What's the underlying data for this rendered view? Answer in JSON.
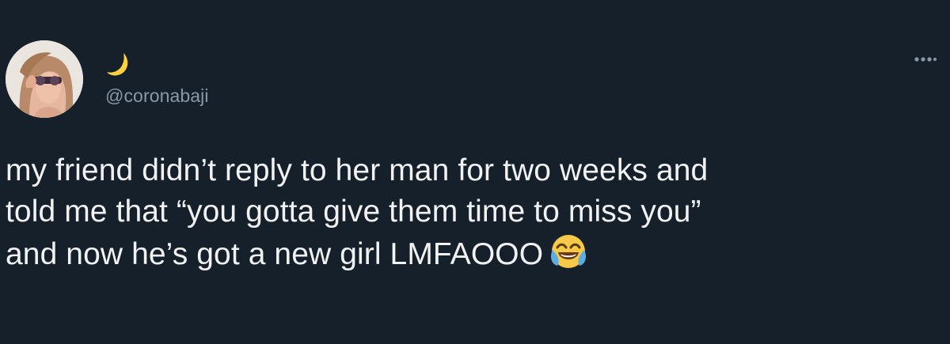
{
  "tweet": {
    "author": {
      "display_name_icon": "crescent-moon-emoji",
      "handle": "@coronabaji",
      "avatar_icon": "profile-photo"
    },
    "more_icon": "more-options-icon",
    "text_lines": [
      "my friend didn’t reply to her man for two weeks and",
      "told me that “you gotta give them time to miss you”",
      "and now he’s got a new girl LMFAOOO"
    ],
    "trailing_emoji": "tears-of-joy-emoji"
  },
  "colors": {
    "background": "#15202b",
    "text": "#f1f2f3",
    "secondary_text": "#8b98a5",
    "moon": "#ffd23f"
  }
}
